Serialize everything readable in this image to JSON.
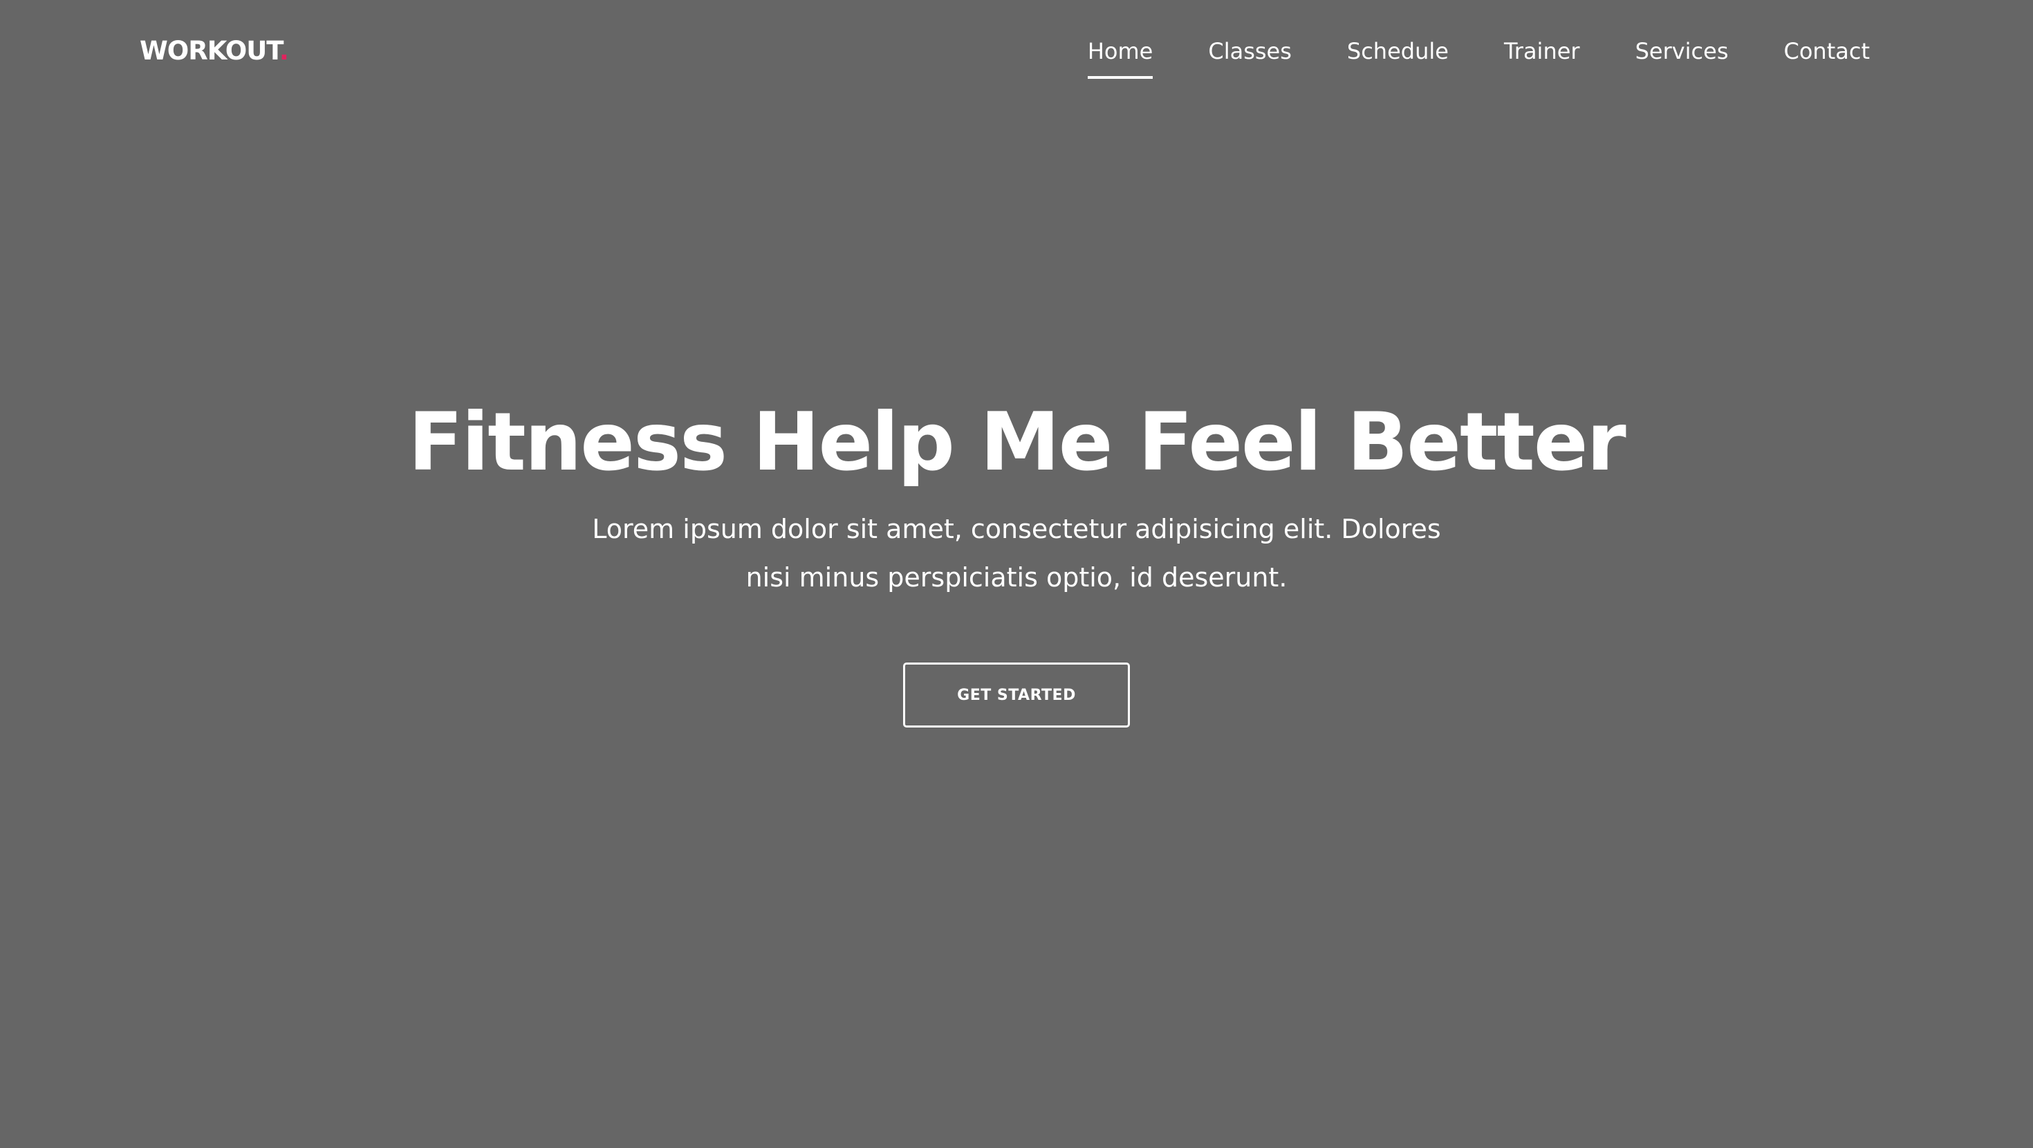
{
  "header": {
    "logo_text": "WORKOUT",
    "logo_dot": ".",
    "nav": [
      {
        "label": "Home",
        "active": true
      },
      {
        "label": "Classes"
      },
      {
        "label": "Schedule"
      },
      {
        "label": "Trainer"
      },
      {
        "label": "Services"
      },
      {
        "label": "Contact"
      }
    ]
  },
  "hero": {
    "title": "Fitness Help Me Feel Better",
    "subtitle": "Lorem ipsum dolor sit amet, consectetur adipisicing elit. Dolores nisi minus perspiciatis optio, id deserunt.",
    "button_label": "GET STARTED"
  },
  "colors": {
    "background": "#666666",
    "text": "#ffffff",
    "accent": "#e0245e"
  }
}
